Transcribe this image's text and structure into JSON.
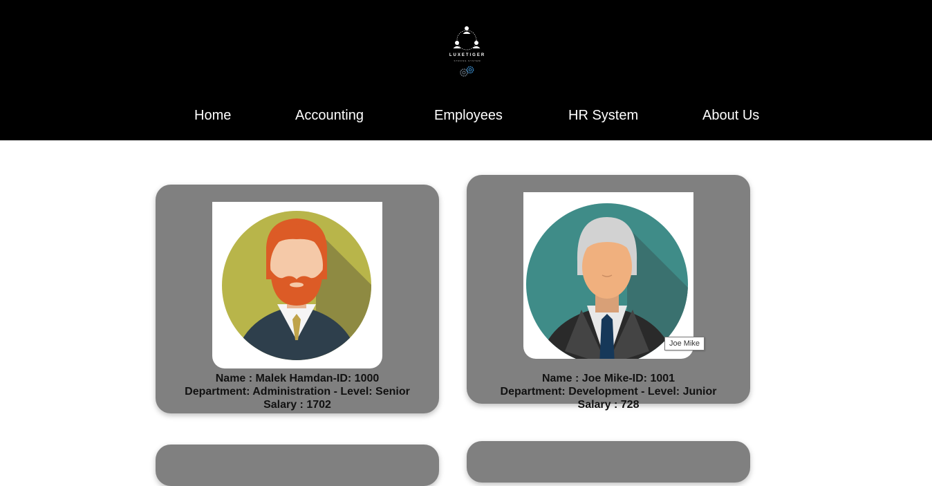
{
  "brand": {
    "name": "LUXETIGER",
    "tagline": "STRONG SYSTEM"
  },
  "nav": {
    "items": [
      {
        "label": "Home"
      },
      {
        "label": "Accounting"
      },
      {
        "label": "Employees"
      },
      {
        "label": "HR System"
      },
      {
        "label": "About Us"
      }
    ]
  },
  "employees": [
    {
      "name_line": "Name : Malek Hamdan-ID: 1000",
      "department_line": "Department: Administration - Level: Senior",
      "salary_line": "Salary : 1702",
      "avatar": "bearded-man-avatar"
    },
    {
      "name_line": "Name : Joe Mike-ID: 1001",
      "department_line": "Department: Development - Level: Junior",
      "salary_line": "Salary : 728",
      "avatar": "grey-haired-man-avatar"
    }
  ],
  "tooltip": {
    "text": "Joe Mike"
  },
  "colors": {
    "header_bg": "#000000",
    "card_bg": "#808080",
    "nav_text": "#ffffff"
  }
}
